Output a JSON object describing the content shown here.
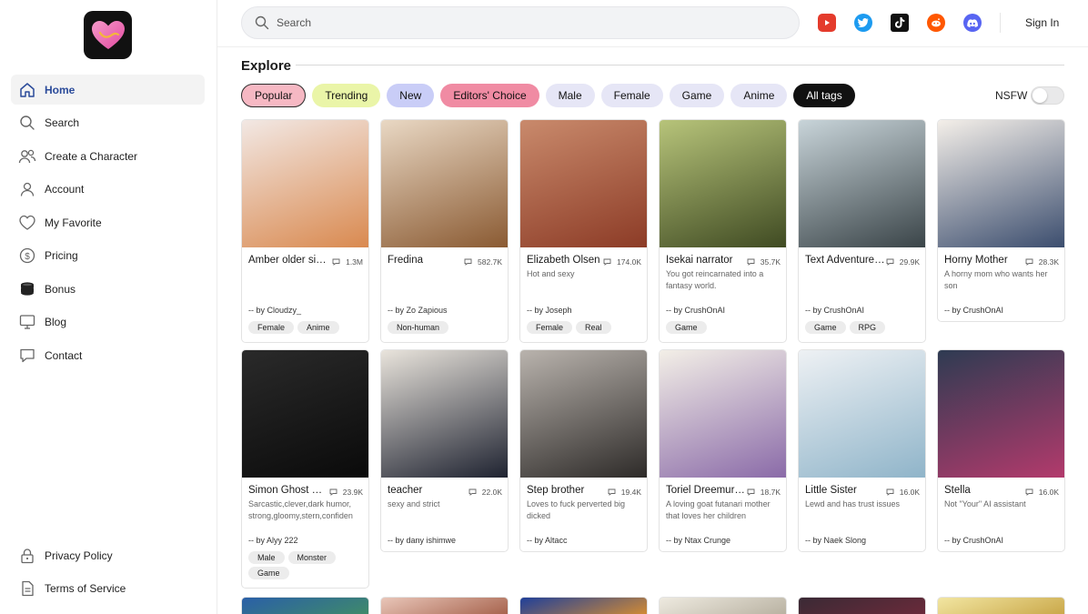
{
  "sidebar": {
    "logo": "heart-logo",
    "items": [
      {
        "label": "Home",
        "icon": "home-icon",
        "active": true
      },
      {
        "label": "Search",
        "icon": "search-icon"
      },
      {
        "label": "Create a Character",
        "icon": "users-icon"
      },
      {
        "label": "Account",
        "icon": "user-icon"
      },
      {
        "label": "My Favorite",
        "icon": "heart-icon"
      },
      {
        "label": "Pricing",
        "icon": "dollar-icon"
      },
      {
        "label": "Bonus",
        "icon": "coins-icon"
      },
      {
        "label": "Blog",
        "icon": "monitor-icon"
      },
      {
        "label": "Contact",
        "icon": "chat-icon"
      }
    ],
    "bottom": [
      {
        "label": "Privacy Policy",
        "icon": "lock-icon"
      },
      {
        "label": "Terms of Service",
        "icon": "document-icon"
      }
    ]
  },
  "topbar": {
    "search_placeholder": "Search",
    "socials": [
      "youtube-icon",
      "twitter-icon",
      "tiktok-icon",
      "reddit-icon",
      "discord-icon"
    ],
    "signin": "Sign In"
  },
  "explore": {
    "title": "Explore",
    "tags": [
      {
        "label": "Popular",
        "bg": "#f6b8c3",
        "border": "#2b2b2b"
      },
      {
        "label": "Trending",
        "bg": "#eaf5a8"
      },
      {
        "label": "New",
        "bg": "#c9cdf7"
      },
      {
        "label": "Editors' Choice",
        "bg": "#f08ba3"
      },
      {
        "label": "Male",
        "bg": "#e6e6f6"
      },
      {
        "label": "Female",
        "bg": "#e6e6f6"
      },
      {
        "label": "Game",
        "bg": "#e6e6f6"
      },
      {
        "label": "Anime",
        "bg": "#e6e6f6"
      },
      {
        "label": "All tags",
        "bg": "#111111",
        "color": "#ffffff"
      }
    ],
    "nsfw_label": "NSFW",
    "nsfw_on": false
  },
  "cards": [
    {
      "title": "Amber older sis...",
      "count": "1.3M",
      "desc": "",
      "author": "-- by Cloudzy_",
      "tags": [
        "Female",
        "Anime"
      ],
      "img": [
        "#f2e8e4",
        "#d9894f"
      ]
    },
    {
      "title": "Fredina",
      "count": "582.7K",
      "desc": "",
      "author": "-- by Zo Zapious",
      "tags": [
        "Non-human"
      ],
      "img": [
        "#e9d8c4",
        "#8a5a32"
      ]
    },
    {
      "title": "Elizabeth Olsen",
      "count": "174.0K",
      "desc": "Hot and sexy",
      "author": "-- by Joseph",
      "tags": [
        "Female",
        "Real"
      ],
      "img": [
        "#c98a6c",
        "#8c3b26"
      ]
    },
    {
      "title": "Isekai narrator",
      "count": "35.7K",
      "desc": "You got reincarnated into a fantasy world.",
      "author": "-- by CrushOnAI",
      "tags": [
        "Game"
      ],
      "img": [
        "#b7c47a",
        "#3f4a22"
      ]
    },
    {
      "title": "Text Adventure ...",
      "count": "29.9K",
      "desc": "",
      "author": "-- by CrushOnAI",
      "tags": [
        "Game",
        "RPG"
      ],
      "img": [
        "#c8d4d9",
        "#3a4448"
      ]
    },
    {
      "title": "Horny Mother",
      "count": "28.3K",
      "desc": "A horny mom who wants her son",
      "author": "-- by CrushOnAI",
      "tags": [],
      "img": [
        "#f4efe9",
        "#3b4d6e"
      ]
    },
    {
      "title": "Simon Ghost Riley",
      "count": "23.9K",
      "desc": "Sarcastic,clever,dark humor, strong,gloomy,stern,confiden",
      "author": "-- by Alyy 222",
      "tags": [
        "Male",
        "Monster",
        "Game"
      ],
      "img": [
        "#2a2a2a",
        "#0a0a0a"
      ]
    },
    {
      "title": "teacher",
      "count": "22.0K",
      "desc": "sexy and strict",
      "author": "-- by dany ishimwe",
      "tags": [],
      "img": [
        "#e9e4dc",
        "#1e2230"
      ]
    },
    {
      "title": "Step brother",
      "count": "19.4K",
      "desc": "Loves to fuck perverted big dicked",
      "author": "-- by Altacc",
      "tags": [],
      "img": [
        "#b9b3ad",
        "#2d2a28"
      ]
    },
    {
      "title": "Toriel Dreemur ...",
      "count": "18.7K",
      "desc": "A loving goat futanari mother that loves her children",
      "author": "-- by Ntax Crunge",
      "tags": [],
      "img": [
        "#f3efe7",
        "#8a6aa8"
      ]
    },
    {
      "title": "Little Sister",
      "count": "16.0K",
      "desc": "Lewd and has trust issues",
      "author": "-- by Naek Slong",
      "tags": [],
      "img": [
        "#eef1f4",
        "#8fb4c9"
      ]
    },
    {
      "title": "Stella",
      "count": "16.0K",
      "desc": "Not \"Your\" AI assistant",
      "author": "-- by CrushOnAI",
      "tags": [],
      "img": [
        "#2e3b52",
        "#b33a6c"
      ]
    }
  ],
  "bottom_row_colors": [
    [
      "#2a5fa8",
      "#3f8a6a"
    ],
    [
      "#e9c6b9",
      "#a7644e"
    ],
    [
      "#1f3f9a",
      "#d08a35"
    ],
    [
      "#eeeae0",
      "#b9b2a2"
    ],
    [
      "#3a2a35",
      "#6a2a3a"
    ],
    [
      "#f2e6a2",
      "#caa84a"
    ]
  ]
}
